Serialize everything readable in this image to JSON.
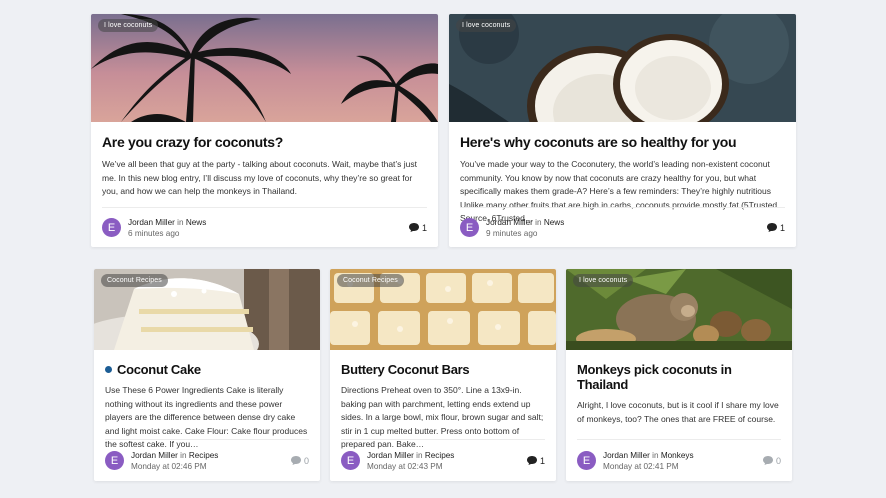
{
  "posts": [
    {
      "tag": "I love coconuts",
      "title": "Are you crazy for coconuts?",
      "excerpt": "We’ve all been that guy at the party - talking about coconuts. Wait, maybe that’s just me. In this new blog entry, I’ll discuss my love of coconuts, why they’re so great for you, and how we can help the monkeys in Thailand.",
      "avatar": "E",
      "author": "Jordan Miller",
      "in": "in",
      "category": "News",
      "time": "6 minutes ago",
      "comments": "1"
    },
    {
      "tag": "I love coconuts",
      "title": "Here's why coconuts are so healthy for you",
      "excerpt": "You’ve made your way to the Coconutery, the world’s leading non-existent coconut community.  You know by now that coconuts are crazy healthy for you, but what specifically makes them grade-A?  Here’s a few reminders:   They’re highly nutritious Unlike many other fruits that are high in carbs, coconuts provide mostly fat (5Trusted Source, 6Trusted…",
      "avatar": "E",
      "author": "Jordan Miller",
      "in": "in",
      "category": "News",
      "time": "9 minutes ago",
      "comments": "1"
    },
    {
      "tag": "Coconut Recipes",
      "title": "Coconut Cake",
      "excerpt": "Use These 6 Power Ingredients Cake is literally nothing without its ingredients and these power players are the difference between dense dry cake and light moist cake. Cake Flour: Cake flour produces the softest cake. If you…",
      "avatar": "E",
      "author": "Jordan Miller",
      "in": "in",
      "category": "Recipes",
      "time": "Monday at 02:46 PM",
      "comments": "0"
    },
    {
      "tag": "Coconut Recipes",
      "title": "Buttery Coconut Bars",
      "excerpt": "Directions Preheat oven to 350°. Line a 13x9-in. baking pan with parchment, letting ends extend up sides. In a large bowl, mix flour, brown sugar and salt; stir in 1 cup melted butter. Press onto bottom of prepared pan. Bake…",
      "avatar": "E",
      "author": "Jordan Miller",
      "in": "in",
      "category": "Recipes",
      "time": "Monday at 02:43 PM",
      "comments": "1"
    },
    {
      "tag": "I love coconuts",
      "title": "Monkeys pick coconuts in Thailand",
      "excerpt": "Alright, I love coconuts, but is it cool if I share my love of monkeys, too?  The ones that are FREE of course.",
      "avatar": "E",
      "author": "Jordan Miller",
      "in": "in",
      "category": "Monkeys",
      "time": "Monday at 02:41 PM",
      "comments": "0"
    }
  ],
  "colors": {
    "accent": "#1c5d95",
    "avatar": "#8a5cc2",
    "background": "#eef0f4"
  }
}
